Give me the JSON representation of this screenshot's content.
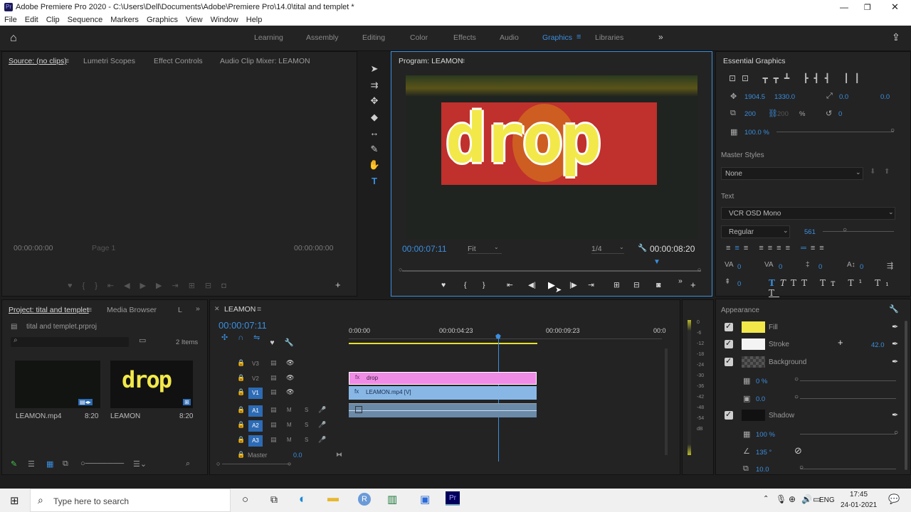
{
  "window": {
    "title": "Adobe Premiere Pro 2020 - C:\\Users\\Dell\\Documents\\Adobe\\Premiere Pro\\14.0\\tital and templet *"
  },
  "menu": [
    "File",
    "Edit",
    "Clip",
    "Sequence",
    "Markers",
    "Graphics",
    "View",
    "Window",
    "Help"
  ],
  "workspaces": {
    "items": [
      "Learning",
      "Assembly",
      "Editing",
      "Color",
      "Effects",
      "Audio",
      "Graphics",
      "Libraries"
    ],
    "active": "Graphics"
  },
  "source_panel": {
    "tabs": [
      "Source: (no clips)",
      "Lumetri Scopes",
      "Effect Controls",
      "Audio Clip Mixer: LEAMON"
    ],
    "timecode_left": "00:00:00:00",
    "page": "Page 1",
    "timecode_right": "00:00:00:00"
  },
  "program_panel": {
    "title": "Program: LEAMON",
    "timecode": "00:00:07:11",
    "fit": "Fit",
    "resolution": "1/4",
    "duration": "00:00:08:20",
    "playhead_fraction": 0.85,
    "video_text": "drop"
  },
  "essential_graphics": {
    "title": "Essential Graphics",
    "position_x": "1904.5",
    "position_y": "1330.0",
    "anchor_x": "0.0",
    "anchor_y": "0.0",
    "scale": "200",
    "scale2": "200",
    "scale_unit": "%",
    "rotation": "0",
    "opacity": "100.0 %",
    "master_styles_label": "Master Styles",
    "master_styles_value": "None",
    "text_label": "Text",
    "font": "VCR OSD Mono",
    "font_style": "Regular",
    "font_size": "561",
    "tracking_vals": [
      "0",
      "0",
      "0",
      "0",
      "0"
    ],
    "leading_val": "0",
    "appearance_label": "Appearance",
    "fill_label": "Fill",
    "fill_color": "#f2e84a",
    "stroke_label": "Stroke",
    "stroke_width": "42.0",
    "background_label": "Background",
    "bg_opacity": "0 %",
    "bg_size": "0.0",
    "shadow_label": "Shadow",
    "shadow_opacity": "100 %",
    "shadow_angle": "135 °",
    "shadow_distance": "10.0"
  },
  "project_panel": {
    "tabs": [
      "Project: tital and templet",
      "Media Browser",
      "L"
    ],
    "file": "tital and templet.prproj",
    "items_count": "2 Items",
    "clips": [
      {
        "name": "LEAMON.mp4",
        "duration": "8:20"
      },
      {
        "name": "LEAMON",
        "duration": "8:20",
        "thumb_text": "drop"
      }
    ]
  },
  "timeline": {
    "tab": "LEAMON",
    "timecode": "00:00:07:11",
    "ruler": [
      "0:00:00",
      "00:00:04:23",
      "00:00:09:23",
      "00:0"
    ],
    "video_tracks": [
      "V3",
      "V2",
      "V1"
    ],
    "audio_tracks": [
      "A1",
      "A2",
      "A3"
    ],
    "master_label": "Master",
    "master_value": "0.0",
    "clips": {
      "v2": "drop",
      "v1": "LEAMON.mp4 [V]"
    },
    "meter_labels": [
      "0",
      "-6",
      "-12",
      "-18",
      "-24",
      "-30",
      "-36",
      "-42",
      "-48",
      "-54",
      "dB"
    ],
    "playhead_fraction": 0.84
  },
  "taskbar": {
    "search_placeholder": "Type here to search",
    "lang": "ENG",
    "time": "17:45",
    "date": "24-01-2021"
  }
}
